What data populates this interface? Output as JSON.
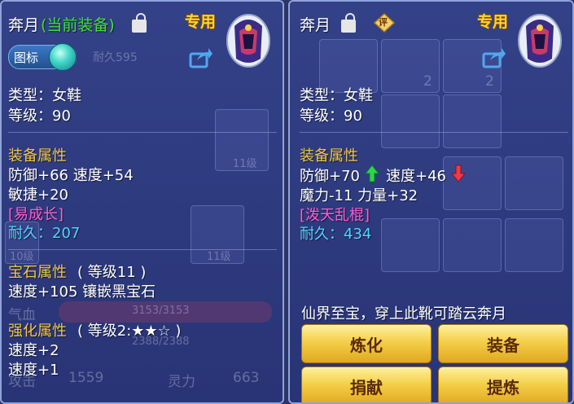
{
  "left": {
    "title": "奔月",
    "title_status": "(当前装备)",
    "special": "专用",
    "tag_button": "图标",
    "type": "类型：女鞋",
    "level": "等级：90",
    "attr_header": "装备属性",
    "attr_line1": "防御+66 速度+54",
    "attr_line2": "敏捷+20",
    "special_skill": "[易成长]",
    "durability": "耐久：207",
    "gem_header": "宝石属性",
    "gem_level": "( 等级11 )",
    "gem_line": "速度+105 镶嵌黑宝石",
    "enh_header": "强化属性",
    "enh_level": "( 等级2:★★☆ )",
    "enh_line1": "速度+2",
    "enh_line2": "速度+1"
  },
  "left_background": {
    "durability_ghost": "耐久595",
    "slot_level_1": "11级",
    "slot_level_2": "11级",
    "slot_level_3": "10级",
    "hp_label": "气血",
    "hp_value": "3153/3153",
    "mp_value": "2388/2388",
    "attack_label": "攻击",
    "attack_value": "1559",
    "spirit_label": "灵力",
    "spirit_value": "663"
  },
  "right": {
    "title": "奔月",
    "rating_label": "评",
    "special": "专用",
    "type": "类型：女鞋",
    "level": "等级：90",
    "attr_header": "装备属性",
    "attr_def": "防御+70",
    "attr_speed": "速度+46",
    "attr_line2": "魔力-11 力量+32",
    "special_skill": "[泼天乱棍]",
    "durability": "耐久：434",
    "description": "仙界至宝，穿上此靴可踏云奔月",
    "buttons": {
      "refine": "炼化",
      "equip": "装备",
      "donate": "捐献",
      "extract": "提炼"
    }
  },
  "right_background": {
    "count_1": "2",
    "count_2": "2"
  },
  "colors": {
    "header_gold": "#f2c64a",
    "status_green": "#3fe03a",
    "skill_pink": "#ff5cd6",
    "durability_cyan": "#54d4ff",
    "button_gold": "#f4cf48"
  },
  "icons": {
    "lock": "lock-icon",
    "share": "share-icon",
    "item": "shoe-item-icon",
    "arrow_up": "arrow-up-icon",
    "arrow_down": "arrow-down-icon",
    "orb": "orb-icon",
    "rating": "rating-badge-icon"
  }
}
